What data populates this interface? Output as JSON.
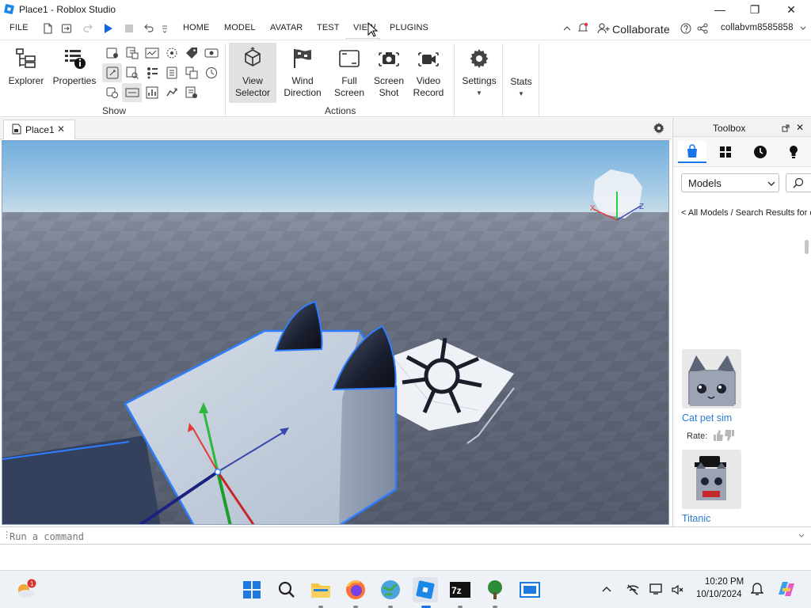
{
  "window": {
    "title": "Place1 - Roblox Studio",
    "minimize_glyph": "—",
    "maximize_glyph": "❐",
    "close_glyph": "✕"
  },
  "menu": {
    "file": "FILE",
    "tabs": [
      "HOME",
      "MODEL",
      "AVATAR",
      "TEST",
      "VIEW",
      "PLUGINS"
    ],
    "active_tab": "VIEW",
    "collaborate": "Collaborate",
    "username": "collabvm8585858"
  },
  "ribbon": {
    "show": {
      "explorer": "Explorer",
      "properties": "Properties",
      "label": "Show"
    },
    "actions": {
      "view_selector_line1": "View",
      "view_selector_line2": "Selector",
      "wind_line1": "Wind",
      "wind_line2": "Direction",
      "full_line1": "Full",
      "full_line2": "Screen",
      "screen_line1": "Screen",
      "screen_line2": "Shot",
      "video_line1": "Video",
      "video_line2": "Record",
      "label": "Actions"
    },
    "settings": "Settings",
    "stats": "Stats"
  },
  "document": {
    "tab_label": "Place1"
  },
  "viewport": {
    "axis_x": "X",
    "axis_z": "Z"
  },
  "toolbox": {
    "title": "Toolbox",
    "category": "Models",
    "breadcrumb": "< All Models / Search Results for c",
    "rate_label": "Rate:",
    "items": [
      {
        "name": "Cat pet sim"
      },
      {
        "name": "Titanic"
      }
    ]
  },
  "command_bar": {
    "placeholder": "Run a command"
  },
  "taskbar": {
    "time": "10:20 PM",
    "date": "10/10/2024",
    "weather_badge": "1",
    "apps": [
      "start",
      "search",
      "file-explorer",
      "firefox",
      "browser-globe",
      "roblox-studio",
      "7zip",
      "game-app",
      "window-app"
    ]
  },
  "colors": {
    "accent": "#1a73e8",
    "selection_outline": "#2f7dff",
    "sky_top": "#7eb6e0",
    "baseplate": "#5b6374"
  }
}
